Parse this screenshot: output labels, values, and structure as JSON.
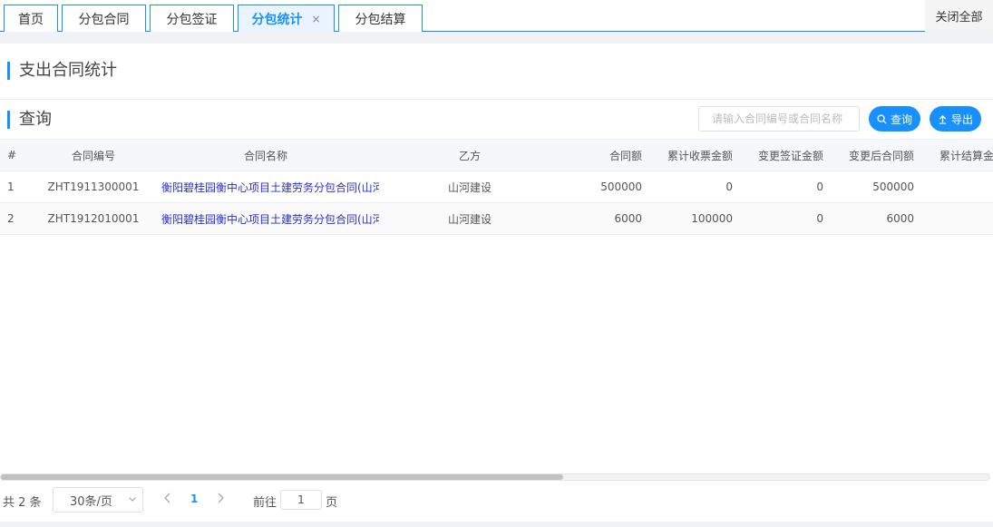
{
  "tabs": [
    {
      "label": "首页",
      "active": false
    },
    {
      "label": "分包合同",
      "active": false
    },
    {
      "label": "分包签证",
      "active": false
    },
    {
      "label": "分包统计",
      "active": true,
      "close": "×"
    },
    {
      "label": "分包结算",
      "active": false
    }
  ],
  "close_all_label": "关闭全部",
  "page_title": "支出合同统计",
  "query": {
    "title": "查询",
    "search_placeholder": "请输入合同编号或合同名称",
    "search_button": "查询",
    "export_button": "导出"
  },
  "table": {
    "columns": [
      "#",
      "合同编号",
      "合同名称",
      "乙方",
      "合同额",
      "累计收票金额",
      "变更签证金额",
      "变更后合同额",
      "累计结算金"
    ],
    "rows": [
      {
        "index": "1",
        "code": "ZHT1911300001",
        "name": "衡阳碧桂园衡中心项目土建劳务分包合同(山河",
        "party": "山河建设",
        "amount": "500000",
        "invoiced": "0",
        "change": "0",
        "after": "500000"
      },
      {
        "index": "2",
        "code": "ZHT1912010001",
        "name": "衡阳碧桂园衡中心项目土建劳务分包合同(山河",
        "party": "山河建设",
        "amount": "6000",
        "invoiced": "100000",
        "change": "0",
        "after": "6000"
      }
    ]
  },
  "pagination": {
    "total": "共 2 条",
    "page_size": "30条/页",
    "current_page": "1",
    "goto_label": "前往",
    "goto_value": "1",
    "goto_suffix": "页"
  },
  "colors": {
    "accent": "#1890ff",
    "link": "#2a2fd4"
  }
}
